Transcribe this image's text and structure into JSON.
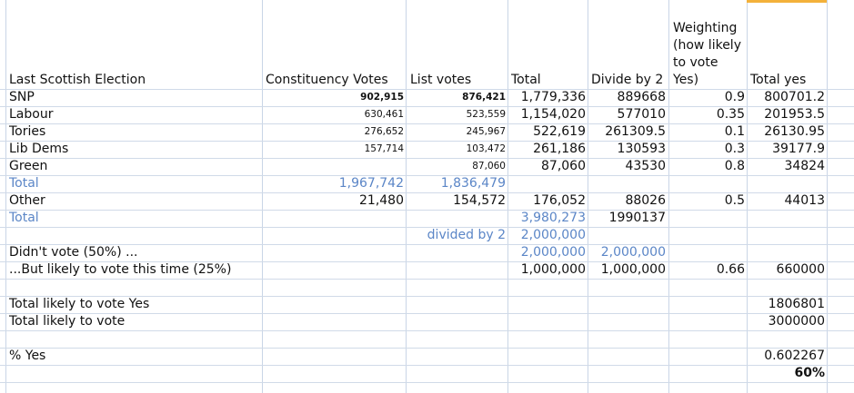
{
  "header": {
    "col_a": "Last Scottish Election",
    "col_b": "Constituency Votes",
    "col_c": "List votes",
    "col_d": "Total",
    "col_e": "Divide by 2",
    "col_f": "Weighting (how likely to vote Yes)",
    "col_g": "Total yes"
  },
  "rows": [
    {
      "a": "SNP",
      "b": "902,915",
      "c": "876,421",
      "d": "1,779,336",
      "e": "889668",
      "f": "0.9",
      "g": "800701.2"
    },
    {
      "a": "Labour",
      "b": "630,461",
      "c": "523,559",
      "d": "1,154,020",
      "e": "577010",
      "f": "0.35",
      "g": "201953.5"
    },
    {
      "a": "Tories",
      "b": "276,652",
      "c": "245,967",
      "d": "522,619",
      "e": "261309.5",
      "f": "0.1",
      "g": "26130.95"
    },
    {
      "a": "Lib Dems",
      "b": "157,714",
      "c": "103,472",
      "d": "261,186",
      "e": "130593",
      "f": "0.3",
      "g": "39177.9"
    },
    {
      "a": "Green",
      "b": "",
      "c": "87,060",
      "d": "87,060",
      "e": "43530",
      "f": "0.8",
      "g": "34824"
    },
    {
      "a": "Total",
      "b": "1,967,742",
      "c": "1,836,479",
      "d": "",
      "e": "",
      "f": "",
      "g": ""
    },
    {
      "a": "Other",
      "b": "21,480",
      "c": "154,572",
      "d": "176,052",
      "e": "88026",
      "f": "0.5",
      "g": "44013"
    },
    {
      "a": "Total",
      "b": "",
      "c": "",
      "d": "3,980,273",
      "e": "1990137",
      "f": "",
      "g": ""
    },
    {
      "a": "",
      "b": "",
      "c": "divided by 2",
      "d": "2,000,000",
      "e": "",
      "f": "",
      "g": ""
    },
    {
      "a": "Didn't vote (50%) ...",
      "b": "",
      "c": "",
      "d": "2,000,000",
      "e": "2,000,000",
      "f": "",
      "g": ""
    },
    {
      "a": "...But likely to vote this time (25%)",
      "b": "",
      "c": "",
      "d": "1,000,000",
      "e": "1,000,000",
      "f": "0.66",
      "g": "660000"
    }
  ],
  "summary": {
    "likely_yes_label": "Total likely to vote Yes",
    "likely_yes_value": "1806801",
    "likely_vote_label": "Total likely to vote",
    "likely_vote_value": "3000000",
    "pct_label": "% Yes",
    "pct_value": "0.602267",
    "pct_rounded": "60%"
  },
  "colors": {
    "gridline": "#c9d5e6",
    "blue_text": "#5b86c7",
    "selection": "#f3b13a"
  }
}
